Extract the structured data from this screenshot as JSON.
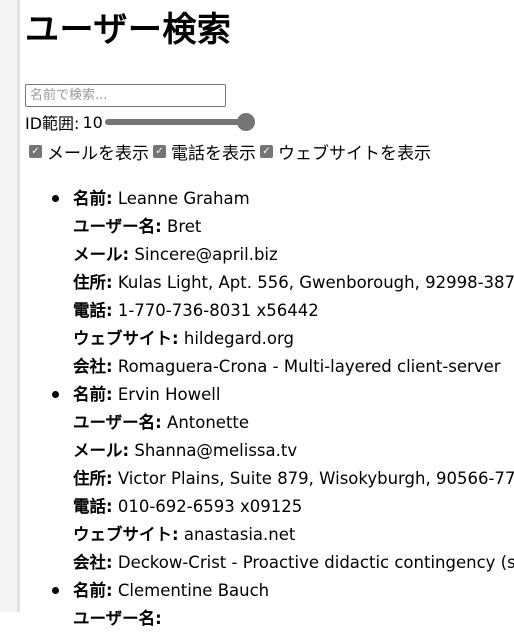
{
  "page": {
    "title": "ユーザー検索"
  },
  "search": {
    "placeholder": "名前で検索...",
    "value": ""
  },
  "range": {
    "label": "ID範囲:",
    "value": "10"
  },
  "toggles": [
    {
      "label": "メールを表示",
      "checked": true
    },
    {
      "label": "電話を表示",
      "checked": true
    },
    {
      "label": "ウェブサイトを表示",
      "checked": true
    }
  ],
  "labels": {
    "name": "名前:",
    "username": "ユーザー名:",
    "email": "メール:",
    "address": "住所:",
    "phone": "電話:",
    "website": "ウェブサイト:",
    "company": "会社:"
  },
  "users": [
    {
      "name": "Leanne Graham",
      "username": "Bret",
      "email": "Sincere@april.biz",
      "address": "Kulas Light, Apt. 556, Gwenborough, 92998-387",
      "phone": "1-770-736-8031 x56442",
      "website": "hildegard.org",
      "company": "Romaguera-Crona - Multi-layered client-server"
    },
    {
      "name": "Ervin Howell",
      "username": "Antonette",
      "email": "Shanna@melissa.tv",
      "address": "Victor Plains, Suite 879, Wisokyburgh, 90566-77",
      "phone": "010-692-6593 x09125",
      "website": "anastasia.net",
      "company": "Deckow-Crist - Proactive didactic contingency (s"
    },
    {
      "name": "Clementine Bauch",
      "username": "",
      "email": "",
      "address": "",
      "phone": "",
      "website": "",
      "company": ""
    }
  ]
}
